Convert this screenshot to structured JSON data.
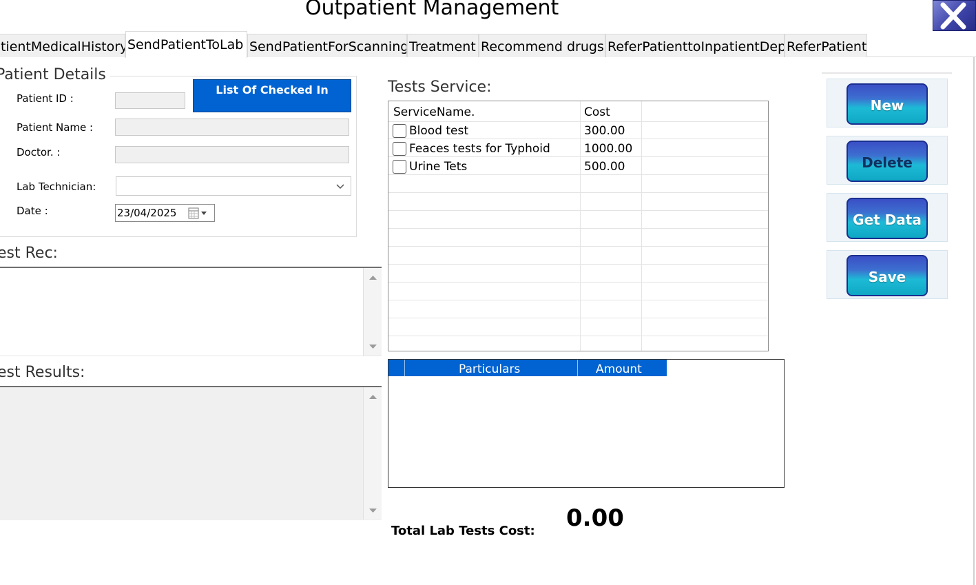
{
  "window": {
    "title": "Outpatient Management"
  },
  "tabs": [
    {
      "label": "tientMedicalHistory"
    },
    {
      "label": "SendPatientToLab"
    },
    {
      "label": "SendPatientForScanning"
    },
    {
      "label": "Treatment"
    },
    {
      "label": "Recommend drugs"
    },
    {
      "label": "ReferPatienttoInpatientDep"
    },
    {
      "label": "ReferPatient"
    }
  ],
  "patient_details": {
    "legend": "Patient Details",
    "patient_id_label": "Patient ID :",
    "patient_id_value": "",
    "patient_name_label": "Patient Name :",
    "patient_name_value": "",
    "doctor_label": "Doctor. :",
    "doctor_value": "",
    "lab_technician_label": "Lab Technician:",
    "lab_technician_value": "",
    "date_label": "Date :",
    "date_value": "23/04/2025",
    "list_checked_in_button": "List Of Checked In"
  },
  "test_rec": {
    "label": "est Rec:",
    "value": ""
  },
  "test_results": {
    "label": "est Results:",
    "value": ""
  },
  "tests_service": {
    "label": "Tests Service:",
    "columns": [
      "ServiceName.",
      "Cost"
    ],
    "rows": [
      {
        "name": "Blood test",
        "cost": "300.00"
      },
      {
        "name": "Feaces tests for Typhoid",
        "cost": "1000.00"
      },
      {
        "name": "Urine Tets",
        "cost": "500.00"
      }
    ]
  },
  "particulars_grid": {
    "columns": [
      "Particulars",
      "Amount"
    ]
  },
  "actions": {
    "new": "New",
    "delete": "Delete",
    "get_data": "Get Data",
    "save": "Save"
  },
  "total": {
    "label": "Total Lab Tests Cost:",
    "value": "0.00"
  },
  "colors": {
    "accent_blue": "#0063d1",
    "button_gradient_top": "#3a4fc5",
    "button_gradient_bottom": "#0fa8c4"
  }
}
